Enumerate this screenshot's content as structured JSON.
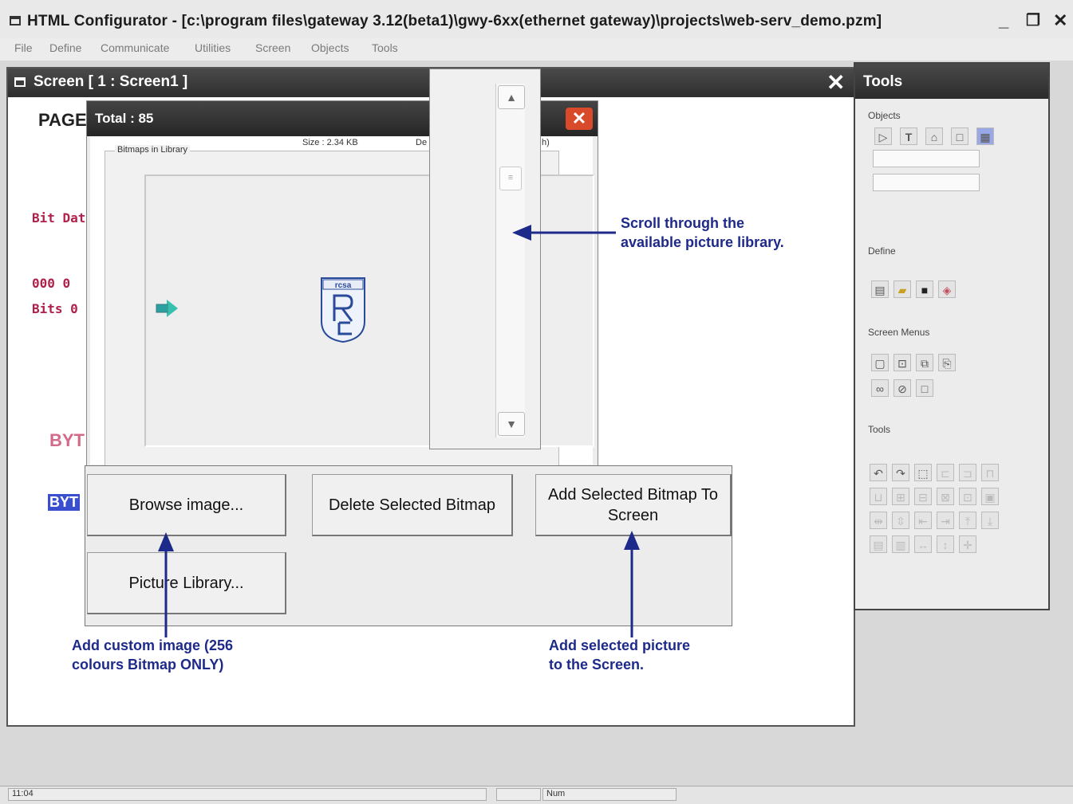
{
  "window": {
    "title": "HTML Configurator - [c:\\program files\\gateway 3.12(beta1)\\gwy-6xx(ethernet gateway)\\projects\\web-serv_demo.pzm]",
    "minimize": "_",
    "restore": "❐",
    "close": "✕"
  },
  "menu": [
    "File",
    "Define",
    "Communicate",
    "Utilities",
    "Screen",
    "Objects",
    "Tools"
  ],
  "screen_window": {
    "title": "Screen [ 1 : Screen1 ]",
    "close": "✕",
    "page_texts": [
      "PAGE",
      "Bit Dat",
      "000  0",
      "Bits 0",
      "BYT",
      "BYT"
    ]
  },
  "bitmap_dialog": {
    "title": "Total : 85",
    "close": "✕",
    "group_label": "Bitmaps in Library",
    "size_label": "Size : 2.34 KB",
    "de_label": "De",
    "bh_label": "h)",
    "buttons": {
      "browse": "Browse image...",
      "delete": "Delete Selected Bitmap",
      "add_line1": "Add  Selected Bitmap To",
      "add_line2": "Screen",
      "library": "Picture Library..."
    }
  },
  "scrollbar": {
    "up": "▲",
    "down": "▼",
    "thumb": "≡"
  },
  "tools_panel": {
    "title": "Tools",
    "sections": [
      "Objects",
      "Define",
      "Screen Menus",
      "Tools"
    ]
  },
  "annotations": {
    "scroll_l1": "Scroll through the",
    "scroll_l2": "available picture library.",
    "browse_l1": "Add custom image (256",
    "browse_l2": "colours Bitmap ONLY)",
    "add_l1": "Add selected picture",
    "add_l2": "to the Screen."
  },
  "status": {
    "time": "11:04",
    "num": "Num"
  },
  "colors": {
    "annotation": "#1e2a8a",
    "dialog_close": "#d84a2a",
    "page_text_red": "#b0204a",
    "page_text_pink": "#d46a8a"
  }
}
